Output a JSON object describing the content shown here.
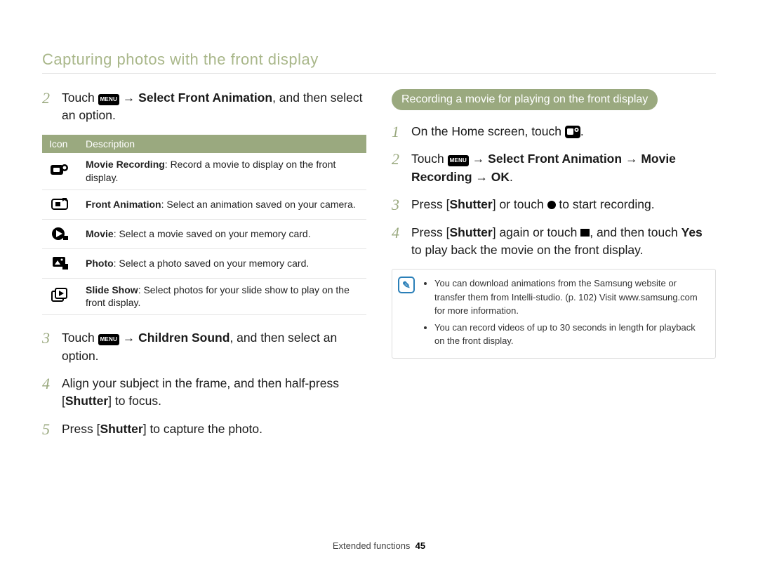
{
  "page_title": "Capturing photos with the front display",
  "left": {
    "step2": {
      "pre": "Touch ",
      "menu": "MENU",
      "arrow": " → ",
      "strong": "Select Front Animation",
      "post": ", and then select an option."
    },
    "table": {
      "header_icon": "Icon",
      "header_desc": "Description",
      "rows": [
        {
          "term": "Movie Recording",
          "desc": ": Record a movie to display on the front display."
        },
        {
          "term": "Front Animation",
          "desc": ": Select an animation saved on your camera."
        },
        {
          "term": "Movie",
          "desc": ": Select a movie saved on your memory card."
        },
        {
          "term": "Photo",
          "desc": ": Select a photo saved on your memory card."
        },
        {
          "term": "Slide Show",
          "desc": ": Select photos for your slide show to play on the front display."
        }
      ]
    },
    "step3": {
      "pre": "Touch ",
      "menu": "MENU",
      "arrow": " → ",
      "strong": "Children Sound",
      "post": ", and then select an option."
    },
    "step4": {
      "pre": "Align your subject in the frame, and then half-press [",
      "strong": "Shutter",
      "post": "] to focus."
    },
    "step5": {
      "pre": "Press [",
      "strong": "Shutter",
      "post": "] to capture the photo."
    },
    "nums": {
      "s2": "2",
      "s3": "3",
      "s4": "4",
      "s5": "5"
    }
  },
  "right": {
    "heading": "Recording a movie for playing on the front display",
    "step1": {
      "pre": "On the Home screen, touch ",
      "post": "."
    },
    "step2": {
      "pre": "Touch ",
      "menu": "MENU",
      "arrow1": " → ",
      "strong1": "Select Front Animation",
      "arrow2": " → ",
      "strong2": "Movie Recording",
      "arrow3": " → ",
      "ok": "OK",
      "post": "."
    },
    "step3": {
      "pre": "Press [",
      "strong": "Shutter",
      "mid": "] or touch ",
      "post": " to start recording."
    },
    "step4": {
      "pre": "Press [",
      "strong1": "Shutter",
      "mid1": "] again or touch ",
      "mid2": ", and then touch ",
      "strong2": "Yes",
      "post": " to play back the movie on the front display."
    },
    "nums": {
      "s1": "1",
      "s2": "2",
      "s3": "3",
      "s4": "4"
    },
    "notes": [
      "You can download animations from the Samsung website or transfer them from Intelli-studio. (p. 102) Visit www.samsung.com for more information.",
      "You can record videos of up to 30 seconds in length for playback on the front display."
    ]
  },
  "footer": {
    "label": "Extended functions",
    "page": "45"
  }
}
